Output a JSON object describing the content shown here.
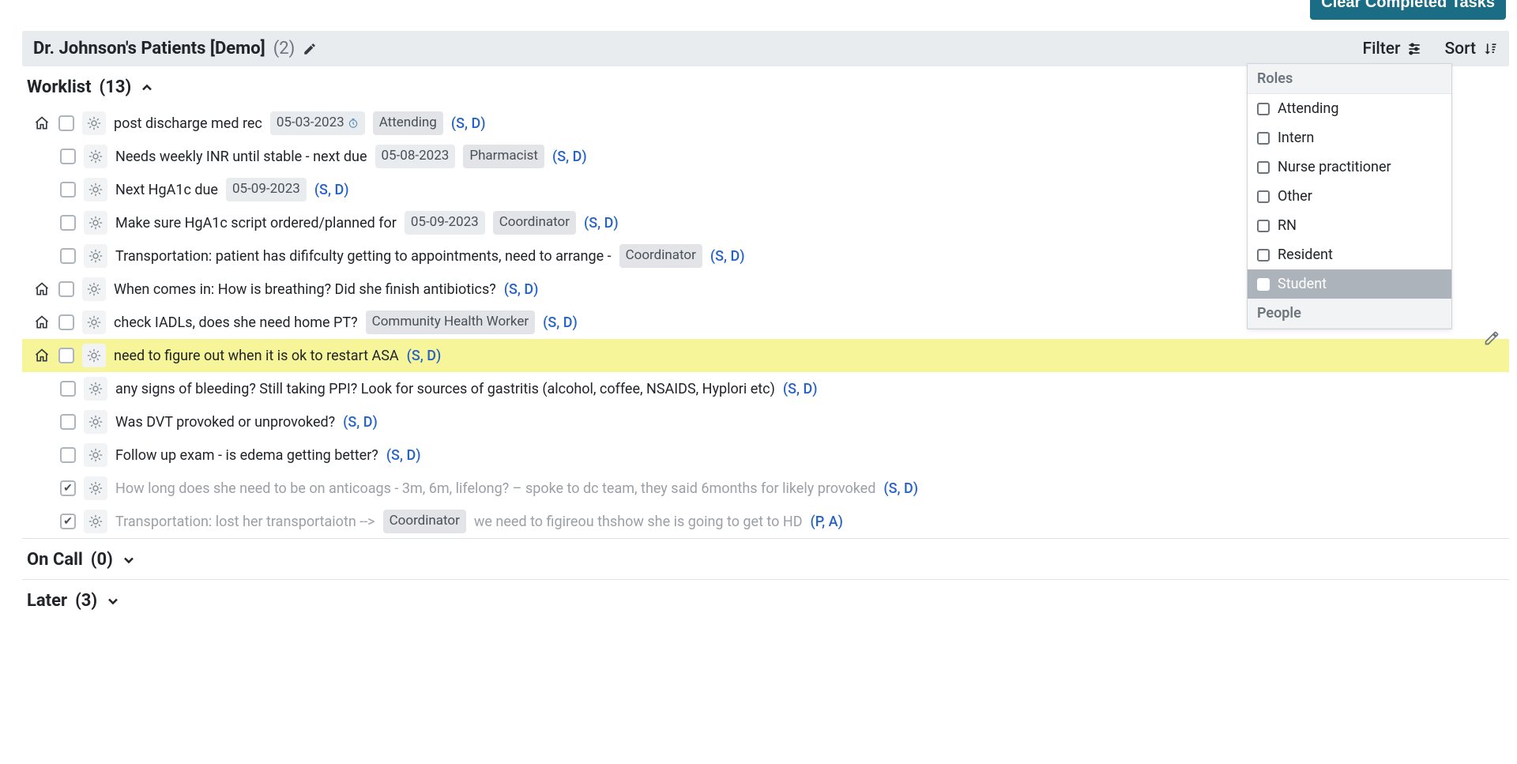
{
  "clear_button": "Clear Completed Tasks",
  "header": {
    "title": "Dr. Johnson's Patients [Demo]",
    "count": "(2)",
    "filter": "Filter",
    "sort": "Sort"
  },
  "sections": {
    "worklist": {
      "label": "Worklist",
      "count": "(13)"
    },
    "oncall": {
      "label": "On Call",
      "count": "(0)"
    },
    "later": {
      "label": "Later",
      "count": "(3)"
    }
  },
  "tasks": [
    {
      "indent": 0,
      "home": true,
      "checked": false,
      "text": "post discharge med rec",
      "date": "05-03-2023",
      "clock": true,
      "role": "Attending",
      "link": "(S, D)"
    },
    {
      "indent": 1,
      "home": false,
      "checked": false,
      "text": "Needs weekly INR until stable - next due",
      "date": "05-08-2023",
      "role": "Pharmacist",
      "link": "(S, D)"
    },
    {
      "indent": 1,
      "home": false,
      "checked": false,
      "text": "Next HgA1c due",
      "date": "05-09-2023",
      "link": "(S, D)"
    },
    {
      "indent": 1,
      "home": false,
      "checked": false,
      "text": "Make sure HgA1c script ordered/planned for",
      "date": "05-09-2023",
      "role": "Coordinator",
      "link": "(S, D)"
    },
    {
      "indent": 1,
      "home": false,
      "checked": false,
      "text": "Transportation:  patient has dififculty getting to appointments, need to arrange  -",
      "role": "Coordinator",
      "link": "(S, D)"
    },
    {
      "indent": 0,
      "home": true,
      "checked": false,
      "text": "When comes in: How is breathing? Did she finish antibiotics?",
      "link": "(S, D)"
    },
    {
      "indent": 0,
      "home": true,
      "checked": false,
      "text": "check IADLs, does she need home PT?",
      "role": "Community Health Worker",
      "link": "(S, D)"
    },
    {
      "indent": 0,
      "home": true,
      "checked": false,
      "text": "need to figure out when it is ok to restart ASA",
      "link": "(S, D)",
      "highlight": true
    },
    {
      "indent": 1,
      "home": false,
      "checked": false,
      "text": "any signs of bleeding? Still taking PPI? Look for sources of gastritis (alcohol, coffee, NSAIDS, Hyplori etc)",
      "link": "(S, D)"
    },
    {
      "indent": 1,
      "home": false,
      "checked": false,
      "text": "Was DVT provoked or unprovoked?",
      "link": "(S, D)"
    },
    {
      "indent": 1,
      "home": false,
      "checked": false,
      "text": "Follow up exam - is edema getting better?",
      "link": "(S, D)"
    },
    {
      "indent": 1,
      "home": false,
      "checked": true,
      "completed": true,
      "text": "How long does she need to be on anticoags - 3m, 6m, lifelong? – spoke to dc team, they said 6months for likely provoked",
      "link": "(S, D)"
    },
    {
      "indent": 1,
      "home": false,
      "checked": true,
      "completed": true,
      "text": "Transportation: lost her transportaiotn -->",
      "role": "Coordinator",
      "text2": "we need to figireou thshow she is going to get to HD",
      "link": "(P, A)"
    }
  ],
  "filter_panel": {
    "roles_heading": "Roles",
    "people_heading": "People",
    "roles": [
      {
        "label": "Attending"
      },
      {
        "label": "Intern"
      },
      {
        "label": "Nurse practitioner"
      },
      {
        "label": "Other"
      },
      {
        "label": "RN"
      },
      {
        "label": "Resident"
      },
      {
        "label": "Student",
        "hovered": true
      }
    ]
  }
}
